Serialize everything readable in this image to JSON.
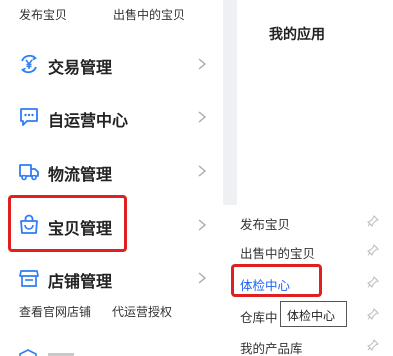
{
  "quick_links": [
    "发布宝贝",
    "出售中的宝贝"
  ],
  "nav": [
    {
      "label": "交易管理",
      "icon": "trade-yen-icon"
    },
    {
      "label": "自运营中心",
      "icon": "chat-bubble-icon"
    },
    {
      "label": "物流管理",
      "icon": "truck-icon"
    },
    {
      "label": "宝贝管理",
      "icon": "shopping-bag-icon"
    },
    {
      "label": "店铺管理",
      "icon": "storefront-icon"
    }
  ],
  "store_links": [
    "查看官网店铺",
    "代运营授权"
  ],
  "apps_title": "我的应用",
  "submenu": [
    {
      "label": "发布宝贝"
    },
    {
      "label": "出售中的宝贝"
    },
    {
      "label": "体检中心"
    },
    {
      "label": "仓库中"
    },
    {
      "label": "我的产品库"
    }
  ],
  "tooltip": "体检中心",
  "colors": {
    "accent": "#1e64f0",
    "highlight": "#e02020",
    "divider": "#eef0f3",
    "icon": "#2f7cf6"
  }
}
